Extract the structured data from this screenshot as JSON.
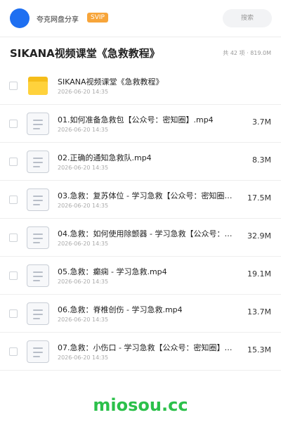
{
  "header": {
    "username": "夸克网盘分享",
    "badge": "SVIP",
    "search_placeholder": "搜索",
    "colors": {
      "avatar": "#1e6ff1",
      "badge": "#f7a53a"
    }
  },
  "folder": {
    "title": "SIKANA视频课堂《急救教程》",
    "meta": "共 42 项 · 819.0M"
  },
  "files": [
    {
      "icon": "folder-icon",
      "name": "SIKANA视频课堂《急救教程》",
      "date": "2026-06-20 14:35",
      "size": ""
    },
    {
      "icon": "document-icon",
      "name": "01.如何准备急救包【公众号：密知圈】.mp4",
      "date": "2026-06-20 14:35",
      "size": "3.7M"
    },
    {
      "icon": "document-icon",
      "name": "02.正确的通知急救队.mp4",
      "date": "2026-06-20 14:35",
      "size": "8.3M"
    },
    {
      "icon": "document-icon",
      "name": "03.急救：复苏体位 - 学习急救【公众号：密知圈…",
      "date": "2026-06-20 14:35",
      "size": "17.5M"
    },
    {
      "icon": "document-icon",
      "name": "04.急救：如何使用除颤器 - 学习急救【公众号：…",
      "date": "2026-06-20 14:35",
      "size": "32.9M"
    },
    {
      "icon": "document-icon",
      "name": "05.急救：癫痫 - 学习急救.mp4",
      "date": "2026-06-20 14:35",
      "size": "19.1M"
    },
    {
      "icon": "document-icon",
      "name": "06.急救：脊椎创伤 - 学习急救.mp4",
      "date": "2026-06-20 14:35",
      "size": "13.7M"
    },
    {
      "icon": "document-icon",
      "name": "07.急救：小伤口 - 学习急救【公众号：密知圈】…",
      "date": "2026-06-20 14:35",
      "size": "15.3M"
    }
  ],
  "watermark": {
    "text": "miosou.cc",
    "color": "#2bc04a"
  }
}
